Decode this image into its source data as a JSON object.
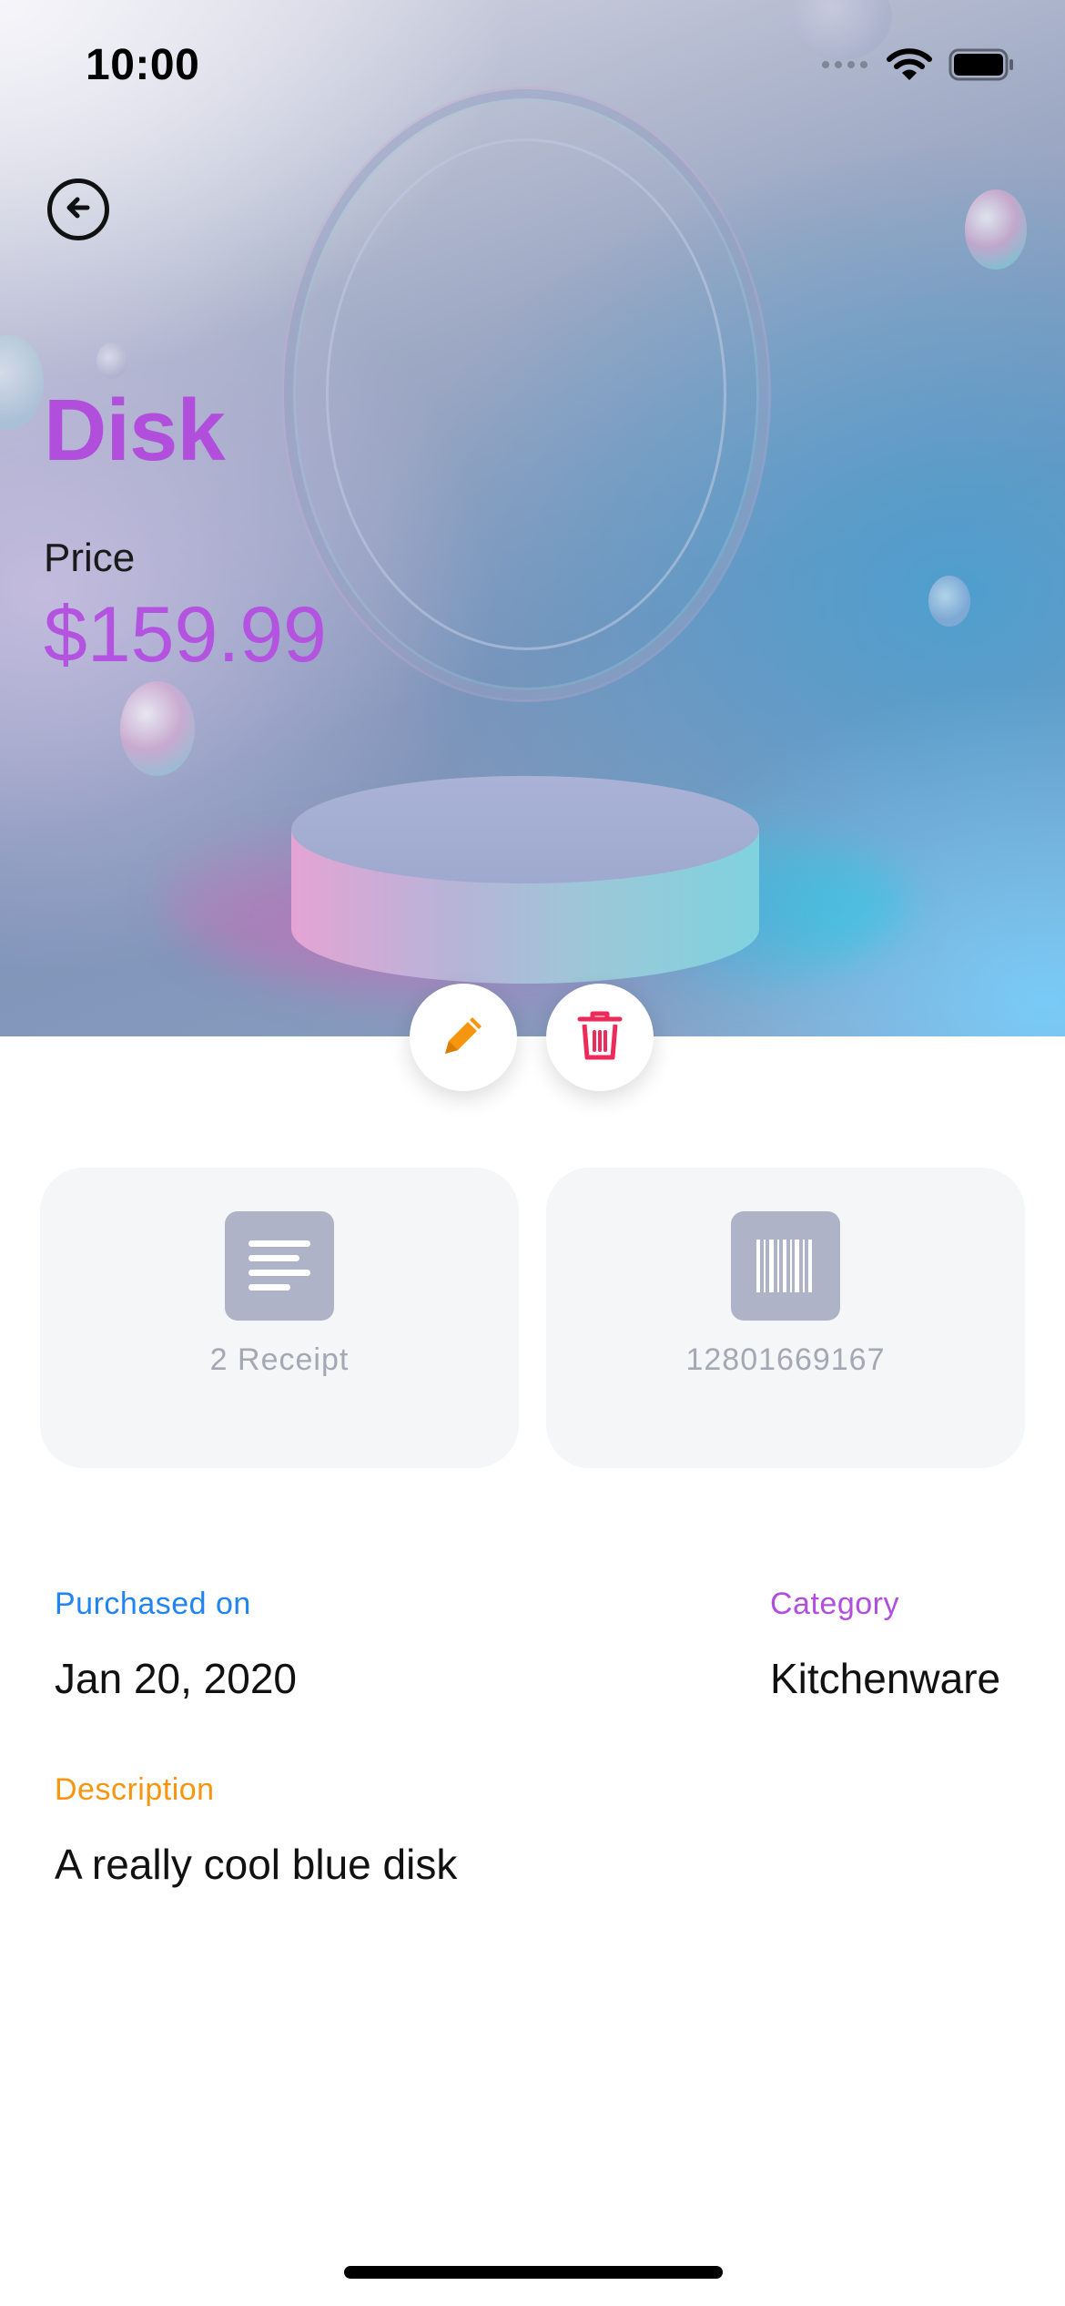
{
  "status_bar": {
    "time": "10:00",
    "icons": [
      "cellular-icon",
      "wifi-icon",
      "battery-icon"
    ]
  },
  "header": {
    "back_icon": "arrow-left-circle-icon"
  },
  "product": {
    "title": "Disk",
    "price_label": "Price",
    "price": "$159.99"
  },
  "actions": {
    "edit_icon": "pencil-icon",
    "delete_icon": "trash-icon"
  },
  "cards": [
    {
      "icon": "receipt-lines-icon",
      "label": "2 Receipt"
    },
    {
      "icon": "barcode-icon",
      "label": "12801669167"
    }
  ],
  "details": {
    "purchased_label": "Purchased on",
    "purchased_value": "Jan 20, 2020",
    "category_label": "Category",
    "category_value": "Kitchenware",
    "description_label": "Description",
    "description_value": "A really cool blue disk"
  },
  "colors": {
    "title": "#b14fdc",
    "price": "#b453e0",
    "purchased_label": "#2184f0",
    "category_label": "#b14fdc",
    "description_label": "#f7950e",
    "edit_icon": "#f7950e",
    "delete_icon": "#ee2a5a",
    "card_background": "#f5f6f8",
    "card_icon_background": "#aeb3c8"
  }
}
